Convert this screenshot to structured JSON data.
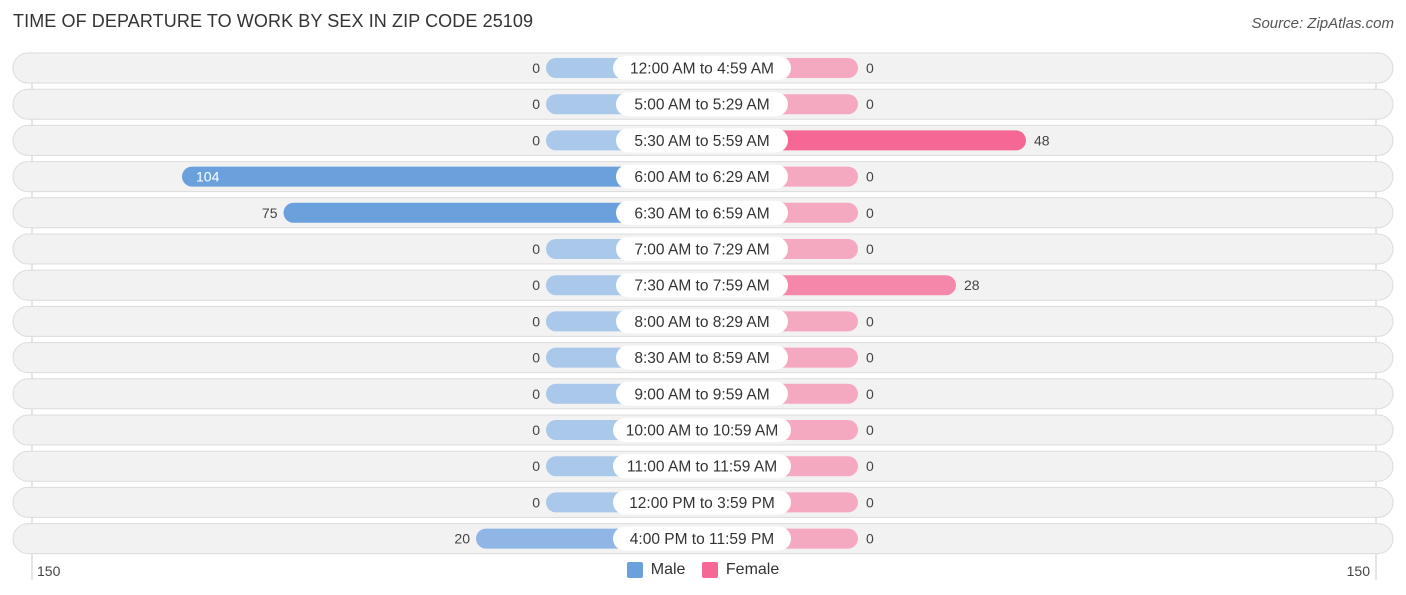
{
  "header": {
    "title": "TIME OF DEPARTURE TO WORK BY SEX IN ZIP CODE 25109",
    "source": "Source: ZipAtlas.com"
  },
  "colors": {
    "male_strong": "#6aa1dd",
    "male_light": "#a9c8ea",
    "female_strong": "#f56896",
    "female_light": "#f5a9c1",
    "row_bg": "#f2f2f2"
  },
  "chart_data": {
    "type": "bar",
    "orientation": "horizontal-diverging",
    "title": "TIME OF DEPARTURE TO WORK BY SEX IN ZIP CODE 25109",
    "categories": [
      "12:00 AM to 4:59 AM",
      "5:00 AM to 5:29 AM",
      "5:30 AM to 5:59 AM",
      "6:00 AM to 6:29 AM",
      "6:30 AM to 6:59 AM",
      "7:00 AM to 7:29 AM",
      "7:30 AM to 7:59 AM",
      "8:00 AM to 8:29 AM",
      "8:30 AM to 8:59 AM",
      "9:00 AM to 9:59 AM",
      "10:00 AM to 10:59 AM",
      "11:00 AM to 11:59 AM",
      "12:00 PM to 3:59 PM",
      "4:00 PM to 11:59 PM"
    ],
    "series": [
      {
        "name": "Male",
        "values": [
          0,
          0,
          0,
          104,
          75,
          0,
          0,
          0,
          0,
          0,
          0,
          0,
          0,
          20
        ]
      },
      {
        "name": "Female",
        "values": [
          0,
          0,
          48,
          0,
          0,
          0,
          28,
          0,
          0,
          0,
          0,
          0,
          0,
          0
        ]
      }
    ],
    "axis": {
      "left_label": "150",
      "right_label": "150",
      "range": [
        -150,
        150
      ]
    },
    "legend": {
      "position": "bottom-center",
      "entries": [
        "Male",
        "Female"
      ]
    },
    "grid": false
  }
}
